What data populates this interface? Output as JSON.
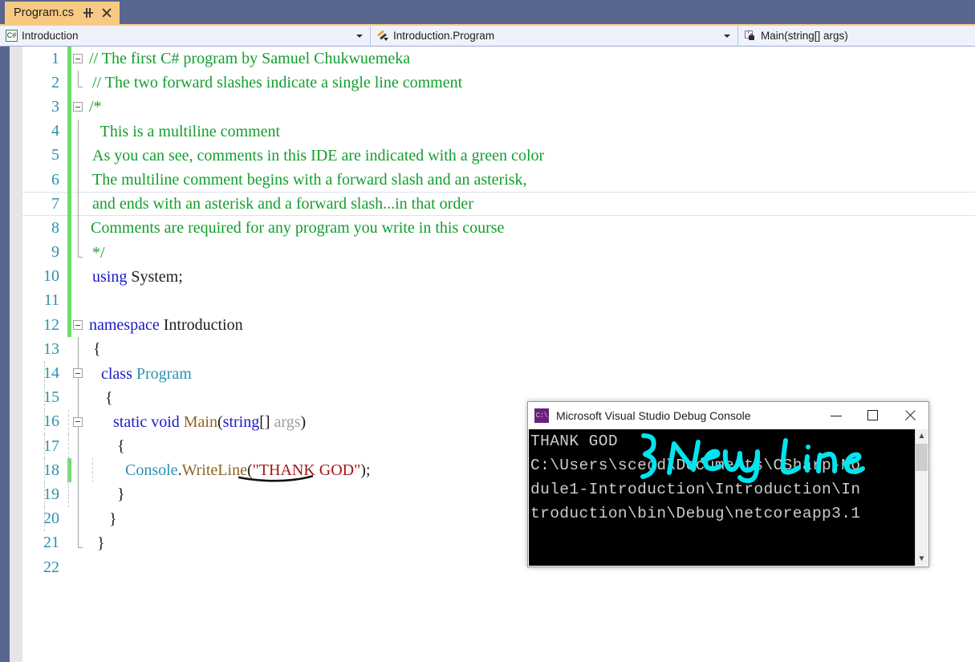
{
  "window": {
    "tab": {
      "title": "Program.cs",
      "pin_icon": "pin-icon",
      "close_icon": "close-icon"
    }
  },
  "nav_bar": {
    "project": {
      "label": "Introduction",
      "icon": "csharp-project-icon"
    },
    "type": {
      "label": "Introduction.Program",
      "icon": "class-icon"
    },
    "member": {
      "label": "Main(string[] args)",
      "icon": "method-private-icon"
    }
  },
  "editor": {
    "lines": [
      {
        "n": "1",
        "changed": true,
        "fold": "open",
        "text": "// The first C# program by Samuel Chukwuemeka"
      },
      {
        "n": "2",
        "changed": true,
        "fold": "end",
        "text": "// The two forward slashes indicate a single line comment"
      },
      {
        "n": "3",
        "changed": true,
        "fold": "open",
        "text": "/*"
      },
      {
        "n": "4",
        "changed": true,
        "fold": "line",
        "text": "  This is a multiline comment"
      },
      {
        "n": "5",
        "changed": true,
        "fold": "line",
        "text": "As you can see, comments in this IDE are indicated with a green color"
      },
      {
        "n": "6",
        "changed": true,
        "fold": "line",
        "text": "The multiline comment begins with a forward slash and an asterisk,"
      },
      {
        "n": "7",
        "changed": true,
        "fold": "line",
        "current": true,
        "text": "and ends with an asterisk and a forward slash...in that order"
      },
      {
        "n": "8",
        "changed": true,
        "fold": "line",
        "text": "Comments are required for any program you write in this course"
      },
      {
        "n": "9",
        "changed": true,
        "fold": "end",
        "text": "*/"
      },
      {
        "n": "10",
        "changed": true,
        "fold": "none",
        "text": "using System;"
      },
      {
        "n": "11",
        "changed": true,
        "fold": "none",
        "text": ""
      },
      {
        "n": "12",
        "changed": true,
        "fold": "open",
        "text": "namespace Introduction"
      },
      {
        "n": "13",
        "changed": false,
        "fold": "line",
        "text": " {"
      },
      {
        "n": "14",
        "changed": false,
        "fold": "open2",
        "text": "   class Program"
      },
      {
        "n": "15",
        "changed": false,
        "fold": "line",
        "text": "    {"
      },
      {
        "n": "16",
        "changed": false,
        "fold": "open3",
        "text": "      static void Main(string[] args)"
      },
      {
        "n": "17",
        "changed": false,
        "fold": "line",
        "text": "       {"
      },
      {
        "n": "18",
        "changed": true,
        "fold": "line",
        "text": "         Console.WriteLine(\"THANK GOD\");"
      },
      {
        "n": "19",
        "changed": false,
        "fold": "line",
        "text": "       }"
      },
      {
        "n": "20",
        "changed": false,
        "fold": "end3",
        "text": "     }"
      },
      {
        "n": "21",
        "changed": false,
        "fold": "end2",
        "text": "  }"
      },
      {
        "n": "22",
        "changed": false,
        "fold": "none",
        "text": ""
      }
    ],
    "annotation_underline": "hand-drawn-underline-under-writeline"
  },
  "console": {
    "title": "Microsoft Visual Studio Debug Console",
    "icon": "cmd-prompt-icon",
    "buttons": {
      "minimize": "minimize-button",
      "maximize": "maximize-button",
      "close": "close-button"
    },
    "output": [
      "THANK GOD",
      "C:\\Users\\scedd\\Documents\\CSharp-Mo",
      "dule1-Introduction\\Introduction\\In",
      "troduction\\bin\\Debug\\netcoreapp3.1"
    ],
    "ink_annotation": "} New line",
    "scrollbar": {
      "up_arrow": "scroll-up-arrow",
      "down_arrow": "scroll-down-arrow"
    }
  },
  "colors": {
    "tab_active": "#f7ca83",
    "chrome": "#57658f",
    "nav_bg": "#f0f2fb",
    "comment": "#139e2e",
    "keyword": "#1a19c9",
    "type": "#2b91af",
    "method": "#8c6524",
    "string": "#a31515",
    "parameter": "#9d9d9d",
    "line_number": "#2b91af",
    "change_bar": "#6ede6a",
    "console_bg": "#000000",
    "console_text": "#cccccc",
    "ink": "#00e5ee"
  }
}
